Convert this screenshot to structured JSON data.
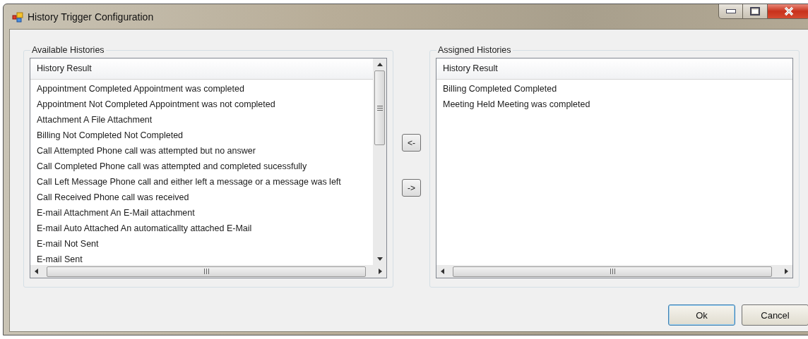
{
  "window": {
    "title": "History Trigger Configuration"
  },
  "available": {
    "legend": "Available Histories",
    "column": "History Result",
    "items": [
      "Appointment Completed Appointment was completed",
      "Appointment Not Completed Appointment was not completed",
      "Attachment A File Attachment",
      "Billing Not Completed Not Completed",
      "Call Attempted Phone call was attempted but no answer",
      "Call Completed Phone call was attempted and completed sucessfully",
      "Call Left Message Phone call and either left a message or a message was left",
      "Call Received Phone call was received",
      "E-mail Attachment An E-Mail attachment",
      "E-mail Auto Attached An automaticallty attached E-Mail",
      "E-mail Not Sent",
      "E-mail Sent"
    ]
  },
  "move_buttons": [
    "<-",
    "->"
  ],
  "assigned": {
    "legend": "Assigned Histories",
    "column": "History Result",
    "items": [
      "Billing Completed Completed",
      "Meeting Held Meeting was completed"
    ]
  },
  "buttons": [
    {
      "label": "Ok",
      "focused": true
    },
    {
      "label": "Cancel",
      "focused": false
    }
  ]
}
